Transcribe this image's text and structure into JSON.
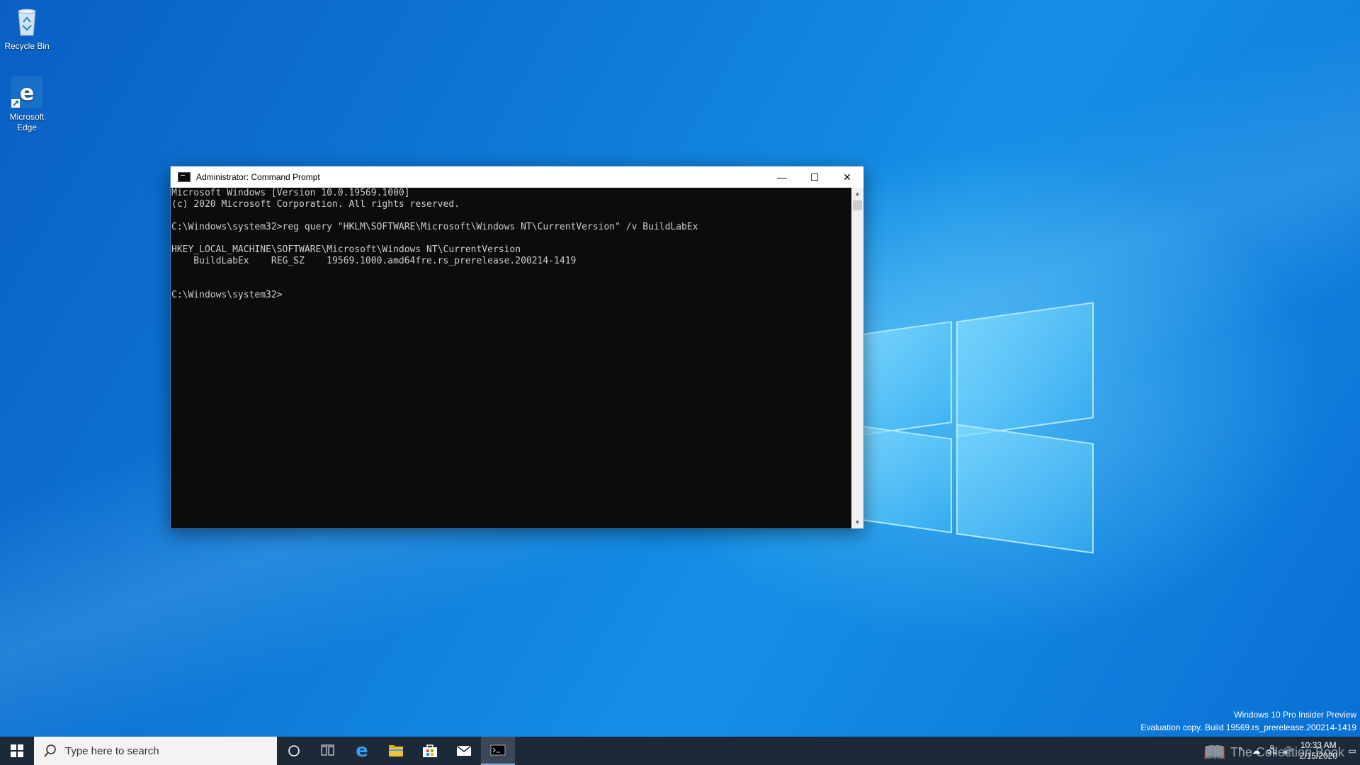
{
  "desktop": {
    "icons": [
      {
        "label": "Recycle Bin",
        "icon": "recycle-bin-icon"
      },
      {
        "label": "Microsoft Edge",
        "icon": "edge-icon"
      }
    ]
  },
  "window": {
    "title": "Administrator: Command Prompt",
    "console_lines": [
      "Microsoft Windows [Version 10.0.19569.1000]",
      "(c) 2020 Microsoft Corporation. All rights reserved.",
      "",
      "C:\\Windows\\system32>reg query \"HKLM\\SOFTWARE\\Microsoft\\Windows NT\\CurrentVersion\" /v BuildLabEx",
      "",
      "HKEY_LOCAL_MACHINE\\SOFTWARE\\Microsoft\\Windows NT\\CurrentVersion",
      "    BuildLabEx    REG_SZ    19569.1000.amd64fre.rs_prerelease.200214-1419",
      "",
      "",
      "C:\\Windows\\system32>"
    ],
    "controls": {
      "minimize": "—",
      "maximize": "☐",
      "close": "✕"
    }
  },
  "watermark": {
    "line1": "Windows 10 Pro Insider Preview",
    "line2": "Evaluation copy. Build 19569.rs_prerelease.200214-1419"
  },
  "taskbar": {
    "search_placeholder": "Type here to search",
    "apps": [
      "cortana-icon",
      "task-view-icon",
      "edge-icon",
      "file-explorer-icon",
      "store-icon",
      "mail-icon",
      "command-prompt-icon"
    ],
    "tray": {
      "time": "10:33 AM",
      "date": "2/15/2020"
    },
    "overlay_brand": "The Collection Book"
  },
  "colors": {
    "console_bg": "#0c0c0c",
    "console_fg": "#cccccc",
    "taskbar": "#1c2a38"
  }
}
